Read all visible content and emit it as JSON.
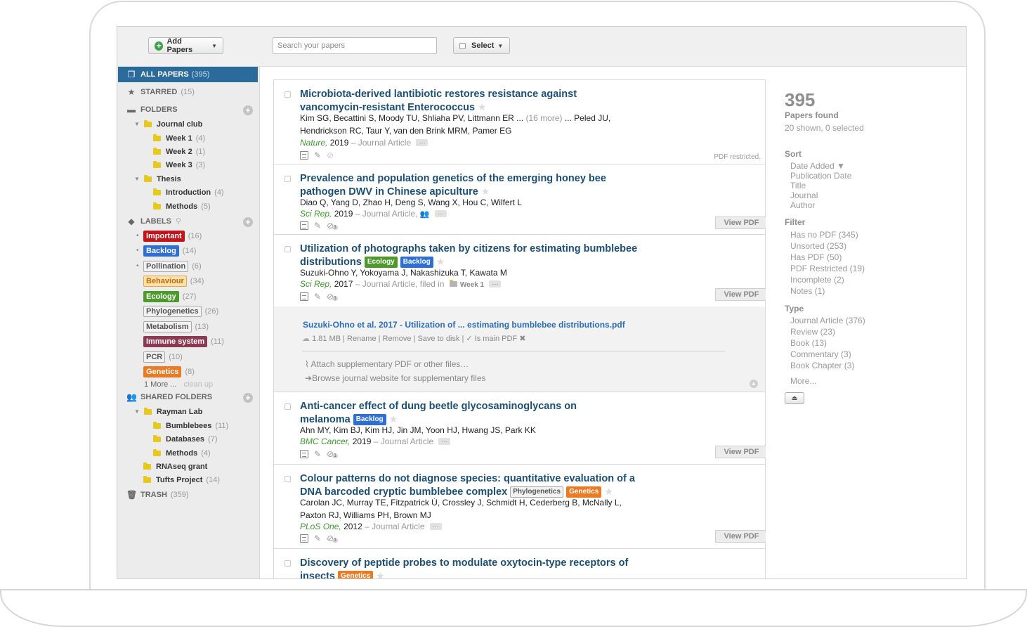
{
  "toolbar": {
    "add_label": "Add Papers",
    "search_placeholder": "Search your papers",
    "select_label": "Select"
  },
  "sidebar": {
    "all_papers": {
      "label": "ALL PAPERS",
      "count": "(395)"
    },
    "starred": {
      "label": "STARRED",
      "count": "(15)"
    },
    "folders_label": "FOLDERS",
    "folders": [
      {
        "name": "Journal club",
        "count": ""
      },
      {
        "name": "Week 1",
        "count": "(4)"
      },
      {
        "name": "Week 2",
        "count": "(1)"
      },
      {
        "name": "Week 3",
        "count": "(3)"
      },
      {
        "name": "Thesis",
        "count": ""
      },
      {
        "name": "Introduction",
        "count": "(4)"
      },
      {
        "name": "Methods",
        "count": "(5)"
      }
    ],
    "labels_label": "LABELS",
    "labels": [
      {
        "name": "Important",
        "count": "(16)",
        "bg": "#c4141b",
        "fg": "#ffffff",
        "border": "#c4141b"
      },
      {
        "name": "Backlog",
        "count": "(14)",
        "bg": "#2d6fd6",
        "fg": "#ffffff",
        "border": "#2d6fd6"
      },
      {
        "name": "Pollination",
        "count": "(6)",
        "bg": "#f2f2f2",
        "fg": "#555555",
        "border": "#a8a8a8"
      },
      {
        "name": "Behaviour",
        "count": "(34)",
        "bg": "#fbe2b4",
        "fg": "#c96a00",
        "border": "#e8a540"
      },
      {
        "name": "Ecology",
        "count": "(27)",
        "bg": "#4c9a2a",
        "fg": "#ffffff",
        "border": "#4c9a2a"
      },
      {
        "name": "Phylogenetics",
        "count": "(26)",
        "bg": "#f2f2f2",
        "fg": "#555555",
        "border": "#a8a8a8"
      },
      {
        "name": "Metabolism",
        "count": "(13)",
        "bg": "#f2f2f2",
        "fg": "#555555",
        "border": "#a8a8a8"
      },
      {
        "name": "Immune system",
        "count": "(11)",
        "bg": "#8c3a54",
        "fg": "#ffffff",
        "border": "#8c3a54"
      },
      {
        "name": "PCR",
        "count": "(10)",
        "bg": "#f2f2f2",
        "fg": "#555555",
        "border": "#a8a8a8"
      },
      {
        "name": "Genetics",
        "count": "(8)",
        "bg": "#ec7a22",
        "fg": "#ffffff",
        "border": "#ec7a22"
      }
    ],
    "labels_more": "1 More ...",
    "labels_cleanup": "clean up",
    "shared_label": "SHARED FOLDERS",
    "shared": [
      {
        "name": "Rayman Lab",
        "count": ""
      },
      {
        "name": "Bumblebees",
        "count": "(11)"
      },
      {
        "name": "Databases",
        "count": "(7)"
      },
      {
        "name": "Methods",
        "count": "(4)"
      },
      {
        "name": "RNAseq grant",
        "count": ""
      },
      {
        "name": "Tufts Project",
        "count": "(14)"
      }
    ],
    "trash": {
      "label": "TRASH",
      "count": "(359)"
    }
  },
  "papers": [
    {
      "title_1": "Microbiota-derived lantibiotic restores resistance against",
      "title_2": "vancomycin-resistant Enterococcus",
      "authors_a": "Kim SG, Becattini S, Moody TU, Shliaha PV, Littmann ER ...",
      "authors_more": "(16 more)",
      "authors_b": "... Peled JU,",
      "authors_2": "Hendrickson RC, Taur Y, van den Brink MRM, Pamer EG",
      "journal": "Nature,",
      "year": "2019",
      "type": "– Journal Article",
      "restricted": "PDF restricted."
    },
    {
      "title_1": "Prevalence and population genetics of the emerging honey bee",
      "title_2": "pathogen DWV in Chinese apiculture",
      "authors": "Diao Q, Yang D, Zhao H, Deng S, Wang X, Hou C, Wilfert L",
      "journal": "Sci Rep,",
      "year": "2019",
      "type": "– Journal Article,",
      "view_pdf": "View PDF"
    },
    {
      "title_1": "Utilization of photographs taken by citizens for estimating bumblebee",
      "title_2": "distributions",
      "tags": [
        "Ecology",
        "Backlog"
      ],
      "authors": "Suzuki-Ohno Y, Yokoyama J, Nakashizuka T, Kawata M",
      "journal": "Sci Rep,",
      "year": "2017",
      "type": "– Journal Article, filed in",
      "folder": "Week 1",
      "view_pdf": "View PDF",
      "pdf_name": "Suzuki-Ohno et al. 2017 - Utilization of ... estimating bumblebee distributions.pdf",
      "pdf_meta": "1.81 MB | Rename | Remove | Save to disk | ✓ Is main PDF ✖",
      "attach": "Attach supplementary PDF or other files…",
      "browse": "Browse journal website for supplementary files"
    },
    {
      "title_1": "Anti-cancer effect of dung beetle glycosaminoglycans on",
      "title_2": "melanoma",
      "tags": [
        "Backlog"
      ],
      "authors": "Ahn MY, Kim BJ, Kim HJ, Jin JM, Yoon HJ, Hwang JS, Park KK",
      "journal": "BMC Cancer,",
      "year": "2019",
      "type": "– Journal Article",
      "view_pdf": "View PDF"
    },
    {
      "title_1": "Colour patterns do not diagnose species: quantitative evaluation of a",
      "title_2": "DNA barcoded cryptic bumblebee complex",
      "tags": [
        "Phylogenetics",
        "Genetics"
      ],
      "authors_1": "Carolan JC, Murray TE, Fitzpatrick Ú, Crossley J, Schmidt H, Cederberg B, McNally L,",
      "authors_2": "Paxton RJ, Williams PH, Brown MJ",
      "journal": "PLoS One,",
      "year": "2012",
      "type": "– Journal Article",
      "view_pdf": "View PDF"
    },
    {
      "title_1": "Discovery of peptide probes to modulate oxytocin-type receptors of",
      "title_2": "insects",
      "tags": [
        "Genetics"
      ]
    }
  ],
  "right_panel": {
    "total": "395",
    "found_label": "Papers found",
    "shown": "20 shown, 0 selected",
    "sort_label": "Sort",
    "sort_options": [
      "Date Added ▼",
      "Publication Date",
      "Title",
      "Journal",
      "Author"
    ],
    "filter_label": "Filter",
    "filter_options": [
      "Has no PDF (345)",
      "Unsorted (253)",
      "Has PDF (50)",
      "PDF Restricted (19)",
      "Incomplete (2)",
      "Notes (1)"
    ],
    "type_label": "Type",
    "type_options": [
      "Journal Article (376)",
      "Review (23)",
      "Book (13)",
      "Commentary (3)",
      "Book Chapter (3)"
    ],
    "more": "More..."
  },
  "icons": {
    "add": "plus-circle-icon",
    "all_papers": "documents-icon",
    "starred": "star-icon",
    "folders": "folder-icon",
    "labels": "tag-icon",
    "shared": "people-icon",
    "trash": "trash-icon"
  }
}
